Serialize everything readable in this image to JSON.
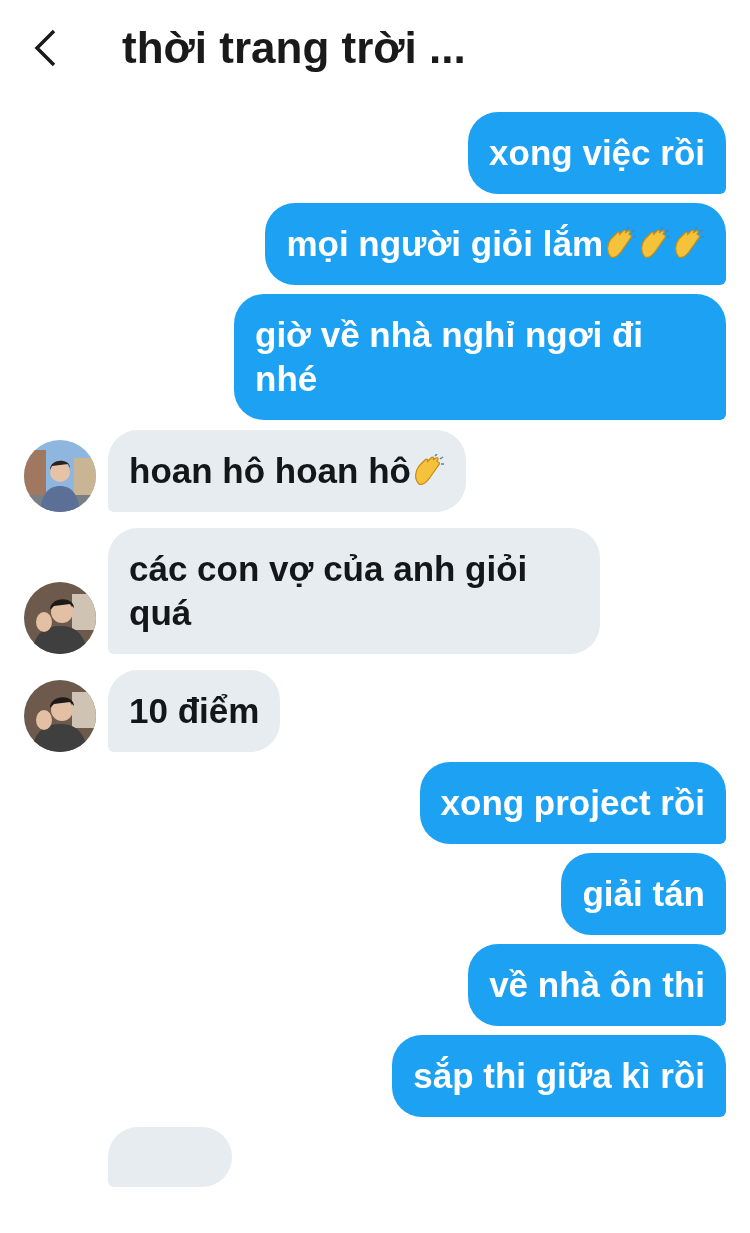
{
  "header": {
    "title": "thời trang trời ..."
  },
  "messages": [
    {
      "kind": "sent",
      "text": "xong việc rồi"
    },
    {
      "kind": "sent",
      "text": "mọi người giỏi lắm",
      "trailing_icons": [
        {
          "kind": "clap"
        },
        {
          "kind": "clap"
        },
        {
          "kind": "clap"
        }
      ]
    },
    {
      "kind": "sent",
      "text": "giờ về nhà nghỉ ngơi đi nhé"
    },
    {
      "kind": "received",
      "text": "hoan hô hoan hô",
      "trailing_icons": [
        {
          "kind": "clap"
        }
      ],
      "avatar": {
        "kind": "street"
      }
    },
    {
      "kind": "received",
      "text": "các con vợ của anh giỏi quá",
      "avatar": {
        "kind": "room"
      }
    },
    {
      "kind": "received",
      "text": "10 điểm",
      "avatar": {
        "kind": "room"
      }
    },
    {
      "kind": "sent",
      "text": "xong project rồi"
    },
    {
      "kind": "sent",
      "text": "giải tán"
    },
    {
      "kind": "sent",
      "text": "về nhà ôn thi"
    },
    {
      "kind": "sent",
      "text": "sắp thi giữa kì rồi"
    },
    {
      "kind": "received",
      "partial": true
    }
  ]
}
